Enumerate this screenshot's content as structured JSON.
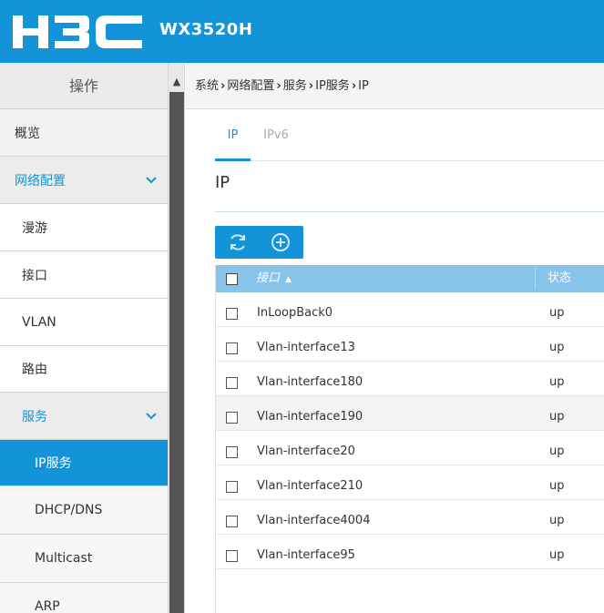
{
  "header": {
    "brand": "H3C",
    "model": "WX3520H"
  },
  "sidebar": {
    "title": "操作",
    "items": [
      {
        "label": "概览"
      },
      {
        "label": "网络配置"
      },
      {
        "label": "漫游"
      },
      {
        "label": "接口"
      },
      {
        "label": "VLAN"
      },
      {
        "label": "路由"
      },
      {
        "label": "服务"
      },
      {
        "label": "IP服务"
      },
      {
        "label": "DHCP/DNS"
      },
      {
        "label": "Multicast"
      },
      {
        "label": "ARP"
      }
    ]
  },
  "breadcrumb": [
    "系统",
    "网络配置",
    "服务",
    "IP服务",
    "IP"
  ],
  "tabs": [
    {
      "label": "IP"
    },
    {
      "label": "IPv6"
    }
  ],
  "section": {
    "title": "IP"
  },
  "toolbar": {
    "icons": [
      "refresh-icon",
      "add-icon"
    ]
  },
  "table": {
    "columns": [
      "接口",
      "状态"
    ],
    "rows": [
      {
        "name": "InLoopBack0",
        "state": "up"
      },
      {
        "name": "Vlan-interface13",
        "state": "up"
      },
      {
        "name": "Vlan-interface180",
        "state": "up"
      },
      {
        "name": "Vlan-interface190",
        "state": "up"
      },
      {
        "name": "Vlan-interface20",
        "state": "up"
      },
      {
        "name": "Vlan-interface210",
        "state": "up"
      },
      {
        "name": "Vlan-interface4004",
        "state": "up"
      },
      {
        "name": "Vlan-interface95",
        "state": "up"
      }
    ]
  },
  "colors": {
    "accent": "#1494d8",
    "table_header": "#88c4ea"
  }
}
